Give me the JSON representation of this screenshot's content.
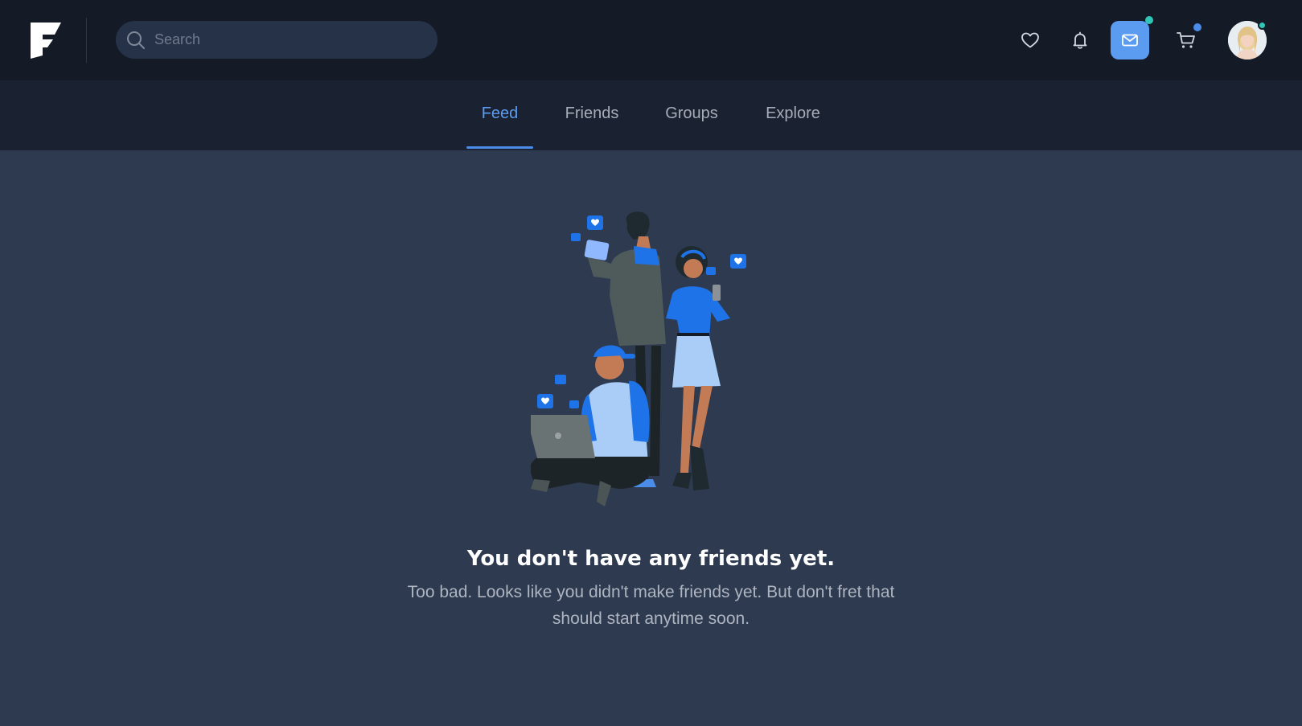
{
  "header": {
    "search": {
      "placeholder": "Search",
      "value": ""
    },
    "icons": {
      "logo": "brand-f-logo",
      "wishlist": "heart-icon",
      "notifications": "bell-icon",
      "messages": "mail-icon",
      "cart": "cart-icon",
      "profile": "user-avatar"
    },
    "badges": {
      "messages_dot_color": "#30c6b7",
      "cart_dot_color": "#4b8ce8",
      "avatar_status_color": "#30c6b7"
    }
  },
  "tabs": [
    {
      "label": "Feed",
      "active": true
    },
    {
      "label": "Friends",
      "active": false
    },
    {
      "label": "Groups",
      "active": false
    },
    {
      "label": "Explore",
      "active": false
    }
  ],
  "empty_state": {
    "title": "You don't have any friends yet.",
    "description": "Too bad. Looks like you didn't make friends yet. But don't fret that should start anytime soon."
  },
  "colors": {
    "topbar": "#141b27",
    "tabbar": "#1a2130",
    "background": "#2e3a50",
    "accent": "#5b9cf0"
  }
}
